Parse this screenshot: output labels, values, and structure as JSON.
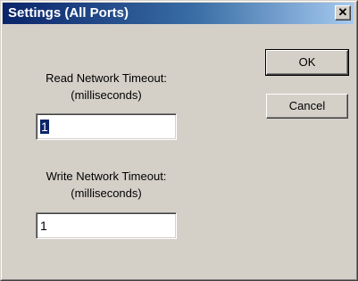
{
  "window": {
    "title": "Settings (All Ports)",
    "close_glyph": "✕"
  },
  "read_timeout": {
    "label_line1": "Read Network Timeout:",
    "label_line2": "(milliseconds)",
    "value": "1"
  },
  "write_timeout": {
    "label_line1": "Write Network Timeout:",
    "label_line2": "(milliseconds)",
    "value": "1"
  },
  "buttons": {
    "ok_label": "OK",
    "cancel_label": "Cancel"
  },
  "colors": {
    "titlebar_start": "#0a246a",
    "titlebar_end": "#a6caf0",
    "face": "#d4d0c8",
    "selection": "#0a246a"
  },
  "icons": {
    "close": "close-icon"
  }
}
